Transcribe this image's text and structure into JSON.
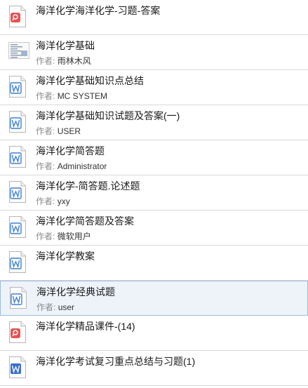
{
  "author_label": "作者:",
  "items": [
    {
      "title": "海洋化学海洋化学-习题-答案",
      "author": "",
      "icon": "pdf-icon"
    },
    {
      "title": "海洋化学基础",
      "author": "雨林木风",
      "icon": "image-thumbnail-icon"
    },
    {
      "title": "海洋化学基础知识点总结",
      "author": "MC SYSTEM",
      "icon": "word-doc-icon"
    },
    {
      "title": "海洋化学基础知识试题及答案(一)",
      "author": "USER",
      "icon": "word-doc-icon"
    },
    {
      "title": "海洋化学简答题",
      "author": "Administrator",
      "icon": "word-doc-icon"
    },
    {
      "title": "海洋化学-简答题.论述题",
      "author": "yxy",
      "icon": "word-doc-icon"
    },
    {
      "title": "海洋化学简答题及答案",
      "author": "微软用户",
      "icon": "word-doc-icon"
    },
    {
      "title": "海洋化学教案",
      "author": "",
      "icon": "word-doc-icon"
    },
    {
      "title": "海洋化学经典试题",
      "author": "user",
      "icon": "word-doc-icon",
      "selected": true
    },
    {
      "title": "海洋化学精品课件-(14)",
      "author": "",
      "icon": "pdf-icon"
    },
    {
      "title": "海洋化学考试复习重点总结与习题(1)",
      "author": "",
      "icon": "word-blue-icon"
    }
  ],
  "colors": {
    "pdf": "#e45353",
    "word": "#3d7fd6",
    "word_solid": "#3b6fd0",
    "selected_bg": "#eef3fa",
    "divider": "#d9d9d9"
  }
}
